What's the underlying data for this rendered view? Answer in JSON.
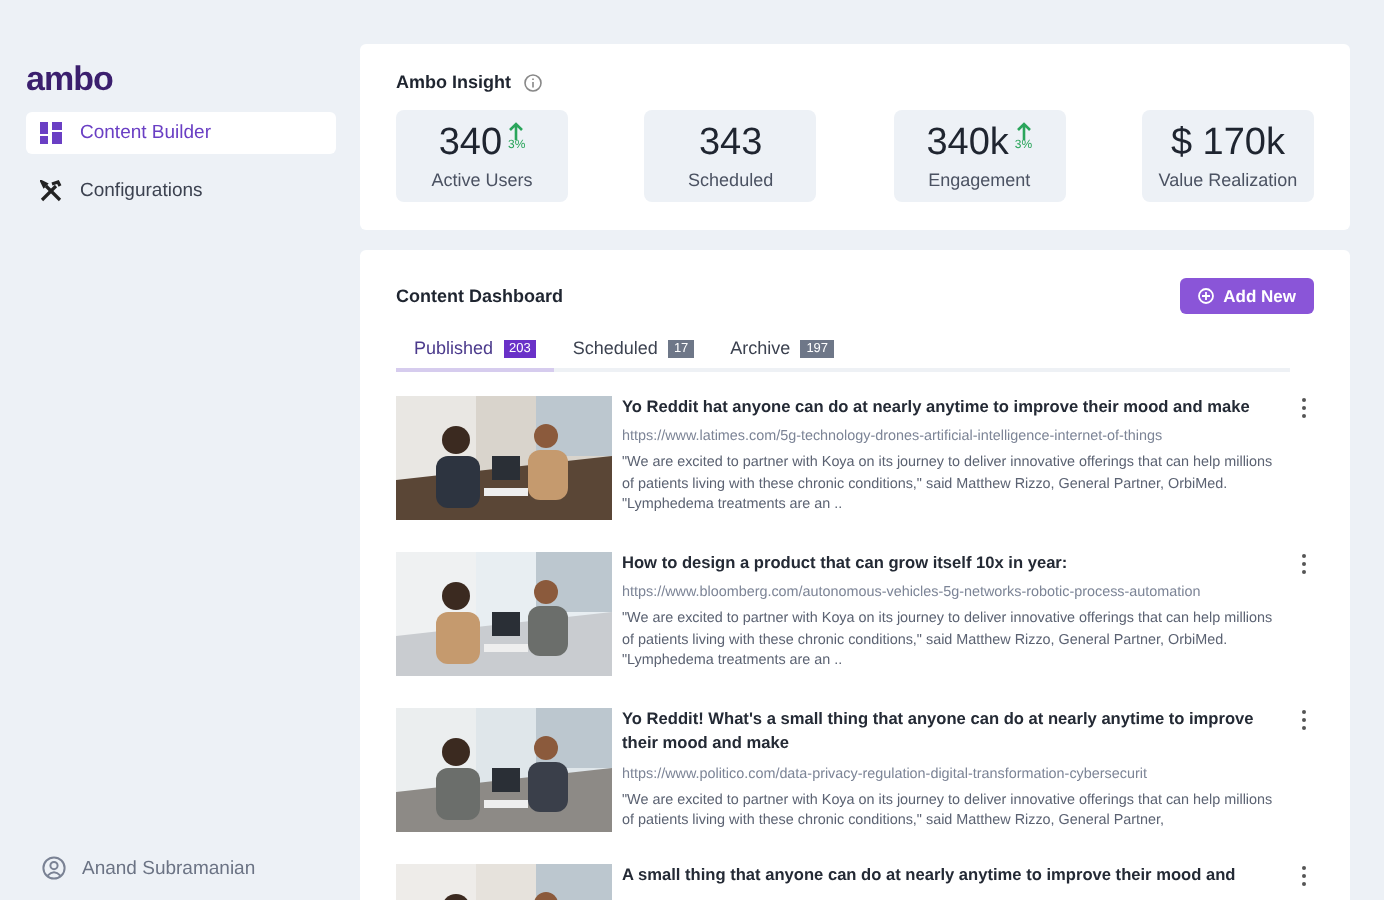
{
  "sidebar": {
    "logo": "ambo",
    "items": [
      {
        "label": "Content Builder",
        "kind": "grid",
        "selected": true
      },
      {
        "label": "Configurations",
        "kind": "tools",
        "selected": false
      }
    ],
    "user": "Anand Subramanian"
  },
  "insight": {
    "title": "Ambo Insight",
    "stats": [
      {
        "value": "340",
        "label": "Active Users",
        "trend": "3%"
      },
      {
        "value": "343",
        "label": "Scheduled"
      },
      {
        "value": "340k",
        "label": "Engagement",
        "trend": "3%"
      },
      {
        "value": "$ 170k",
        "label": "Value Realization"
      }
    ]
  },
  "dashboard": {
    "title": "Content Dashboard",
    "add_button": "Add New",
    "tabs": [
      {
        "label": "Published",
        "count": "203",
        "selected": true
      },
      {
        "label": "Scheduled",
        "count": "17",
        "selected": false
      },
      {
        "label": "Archive",
        "count": "197",
        "selected": false
      }
    ],
    "articles": [
      {
        "title": "Yo Reddit hat anyone can do at nearly anytime to improve their mood and make",
        "url": "https://www.latimes.com/5g-technology-drones-artificial-intelligence-internet-of-things",
        "description": "\"We are excited to partner with Koya on its journey to deliver innovative offerings that can help millions of patients living with these chronic conditions,\" said Matthew Rizzo, General Partner, OrbiMed. \"Lymphedema treatments are an ..",
        "kind": "picture"
      },
      {
        "title": "How to design a product that can grow itself 10x in year:",
        "url": "https://www.bloomberg.com/autonomous-vehicles-5g-networks-robotic-process-automation",
        "description": "\"We are excited to partner with Koya on its journey to deliver innovative offerings that can help millions of patients living with these chronic conditions,\" said Matthew Rizzo, General Partner, OrbiMed. \"Lymphedema treatments are an ..",
        "kind": "picture"
      },
      {
        "title": "Yo Reddit! What's a small thing that anyone can do at nearly anytime to improve their mood and make",
        "url": "https://www.politico.com/data-privacy-regulation-digital-transformation-cybersecurit",
        "description": "\"We are excited to partner with Koya on its journey to deliver innovative offerings that can help millions of patients living with these chronic conditions,\" said Matthew Rizzo, General Partner,",
        "kind": "picture"
      },
      {
        "title": "A small thing that anyone can do at nearly anytime to improve their mood and",
        "kind": "picture"
      }
    ]
  }
}
